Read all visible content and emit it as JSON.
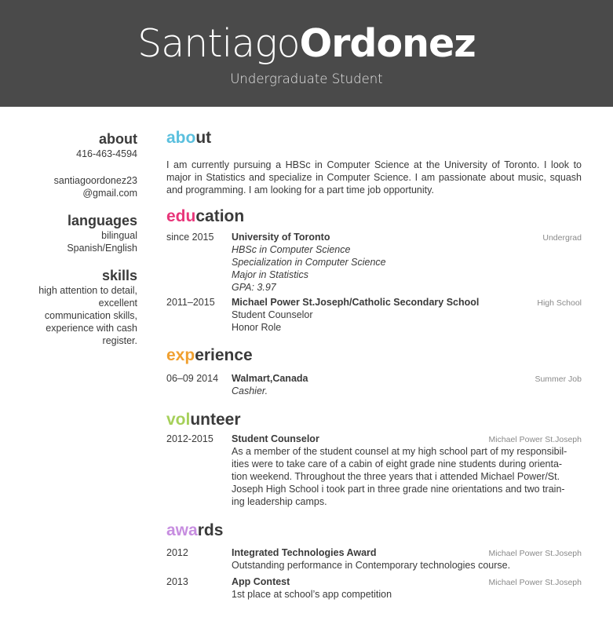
{
  "header": {
    "first_name": "Santiago",
    "last_name": "Ordonez",
    "subtitle": "Undergraduate Student"
  },
  "sidebar": {
    "about_heading": "about",
    "phone": "416-463-4594",
    "email_line1": "santiagoordonez23",
    "email_line2": "@gmail.com",
    "languages_heading": "languages",
    "languages": [
      "bilingual",
      "Spanish/English"
    ],
    "skills_heading": "skills",
    "skills": [
      "high attention to detail,",
      "excellent",
      "communication skills,",
      "experience with cash",
      "register."
    ]
  },
  "colors": {
    "about": "#5bc0de",
    "education": "#e8367a",
    "experience": "#f0a030",
    "volunteer": "#a6d05a",
    "awards": "#c78ee0"
  },
  "sections": {
    "about": {
      "title_accent": "abo",
      "title_rest": "ut",
      "text": "I am currently pursuing a HBSc in Computer Science at the University of Toronto.  I look to major in Statistics and specialize in Computer Science.  I am passionate about music, squash and programming. I am looking for a part time job opportunity."
    },
    "education": {
      "title_accent": "edu",
      "title_rest": "cation",
      "entries": [
        {
          "date": "since 2015",
          "title": "University of Toronto",
          "location": "Undergrad",
          "lines": [
            "HBSc in Computer Science",
            "Specialization in Computer Science",
            "Major in Statistics",
            "GPA: 3.97"
          ]
        },
        {
          "date": "2011–2015",
          "title": "Michael Power St.Joseph/Catholic Secondary School",
          "location": "High School",
          "lines": [
            "Student Counselor",
            "Honor Role"
          ]
        }
      ]
    },
    "experience": {
      "title_accent": "exp",
      "title_rest": "erience",
      "entries": [
        {
          "date": "06–09 2014",
          "title": "Walmart,Canada",
          "location": "Summer Job",
          "lines": [
            "Cashier."
          ]
        }
      ]
    },
    "volunteer": {
      "title_accent": "vol",
      "title_rest": "unteer",
      "entries": [
        {
          "date": "2012-2015",
          "title": "Student Counselor",
          "location": "Michael Power St.Joseph",
          "lines": [
            "As a member of the student counsel at my high school part of my responsibil-",
            "ities were to take care of a cabin of eight grade nine students during orienta-",
            "tion weekend.  Throughout the three years that i attended Michael Power/St.",
            "Joseph High School i took part in three grade nine orientations and two train-",
            "ing leadership camps."
          ]
        }
      ]
    },
    "awards": {
      "title_accent": "awa",
      "title_rest": "rds",
      "entries": [
        {
          "date": "2012",
          "title": "Integrated Technologies Award",
          "location": "Michael Power St.Joseph",
          "lines": [
            "Outstanding performance in Contemporary technologies course."
          ]
        },
        {
          "date": "2013",
          "title": "App Contest",
          "location": "Michael Power St.Joseph",
          "lines": [
            "1st place at school’s app competition"
          ]
        }
      ]
    }
  }
}
